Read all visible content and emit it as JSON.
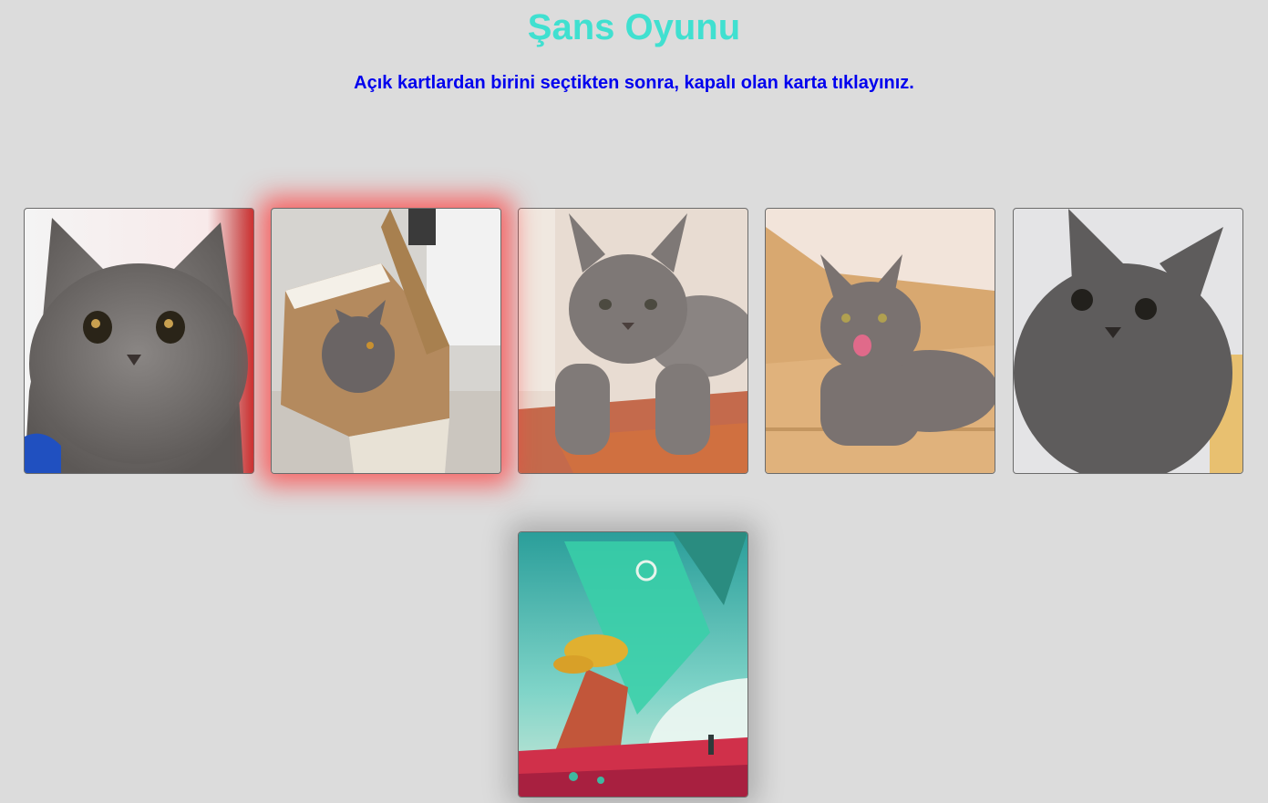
{
  "header": {
    "title": "Şans Oyunu",
    "instruction": "Açık kartlardan birini seçtikten sonra, kapalı olan karta tıklayınız."
  },
  "colors": {
    "background": "#dcdcdc",
    "title": "#40e0d0",
    "instruction": "#0000ee",
    "selected_glow": "#ff3c3c"
  },
  "open_cards": [
    {
      "name": "cat-photo-1",
      "selected": false,
      "content": "grey cat close-up"
    },
    {
      "name": "cat-photo-2",
      "selected": true,
      "content": "grey cat in cardboard box"
    },
    {
      "name": "cat-photo-3",
      "selected": false,
      "content": "grey cat lying on rug"
    },
    {
      "name": "cat-photo-4",
      "selected": false,
      "content": "grey cat on wooden floor"
    },
    {
      "name": "cat-photo-5",
      "selected": false,
      "content": "grey cat portrait"
    }
  ],
  "closed_card": {
    "name": "closed-card-back",
    "content": "sci-fi landscape artwork"
  }
}
